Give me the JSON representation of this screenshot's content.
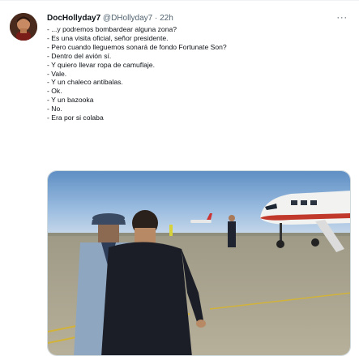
{
  "tweet": {
    "display_name": "DocHollyday7",
    "handle": "@DHollyday7",
    "separator": "·",
    "time": "22h",
    "more_label": "···",
    "lines": [
      "- ...y podremos bombardear alguna zona?",
      "- Es una visita oficial, señor presidente.",
      "- Pero cuando lleguemos sonará de fondo Fortunate Son?",
      "- Dentro del avión sí.",
      "- Y quiero llevar ropa de camuflaje.",
      "- Vale.",
      "- Y un chaleco antibalas.",
      "- Ok.",
      "- Y un bazooka",
      "- No.",
      "- Era por si colaba"
    ]
  },
  "colors": {
    "text": "#0f1419",
    "muted": "#536471",
    "border": "#cfd9de"
  },
  "icons": [
    "avatar",
    "more-icon",
    "photo"
  ]
}
